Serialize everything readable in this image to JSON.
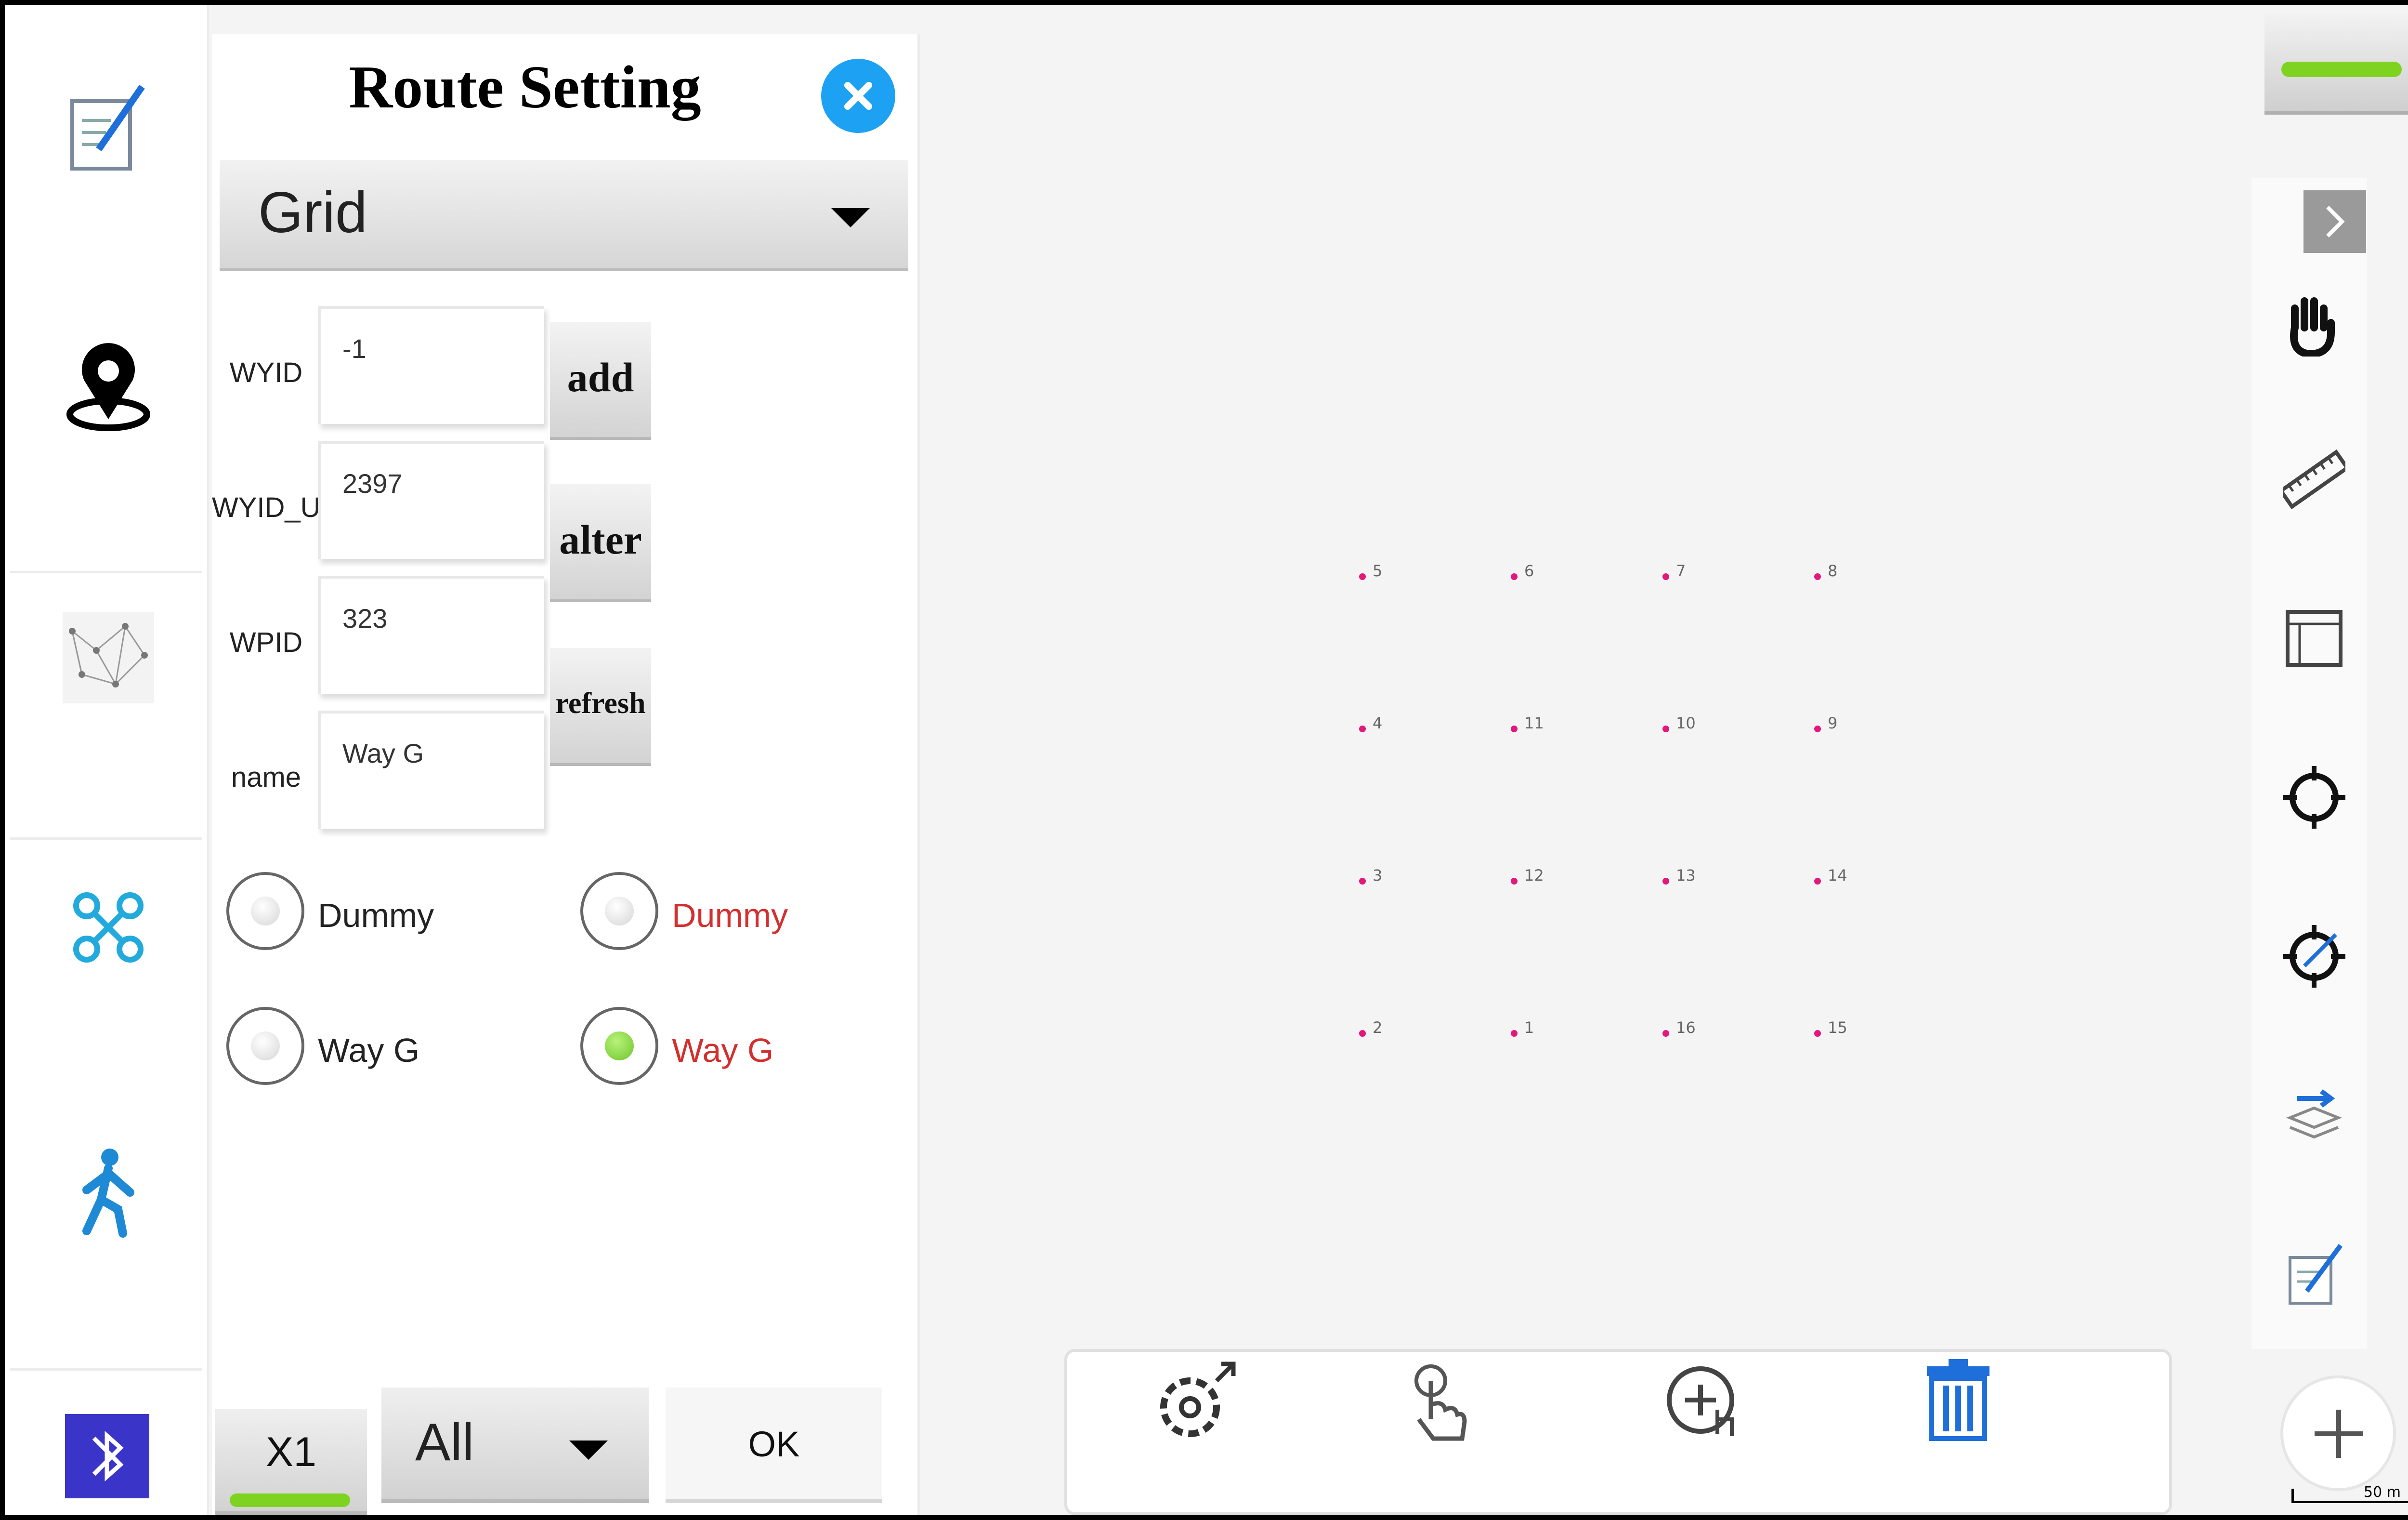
{
  "panel": {
    "title": "Route Setting",
    "route_type": "Grid",
    "fields": [
      {
        "label": "WYID",
        "value": "-1"
      },
      {
        "label": "WYID_U",
        "value": "2397"
      },
      {
        "label": "WPID",
        "value": "323"
      },
      {
        "label": "name",
        "value": "Way G"
      }
    ],
    "buttons": {
      "add": "add",
      "alter": "alter",
      "refresh": "refresh"
    },
    "radios_left": [
      {
        "label": "Dummy",
        "checked": false
      },
      {
        "label": "Way G",
        "checked": false
      }
    ],
    "radios_right": [
      {
        "label": "Dummy",
        "checked": false
      },
      {
        "label": "Way G",
        "checked": true
      }
    ],
    "bottom": {
      "speed": "X1",
      "filter": "All",
      "ok": "OK"
    }
  },
  "left_nav": [
    "edit-note-icon",
    "location-pin-icon",
    "network-map-icon",
    "drone-icon",
    "walking-person-icon",
    "bluetooth-icon"
  ],
  "right_toolbar": [
    "expand-arrow-icon",
    "hand-pan-icon",
    "ruler-icon",
    "frame-icon",
    "crosshair-icon",
    "crosshair-edit-icon",
    "layers-export-icon",
    "edit-note-icon",
    "zoom-in-icon"
  ],
  "map_toolbar": [
    "settings-icon",
    "touch-icon",
    "add-point-icon",
    "delete-icon"
  ],
  "waypoints": [
    {
      "label": "5",
      "col": 0,
      "row": 0
    },
    {
      "label": "6",
      "col": 1,
      "row": 0
    },
    {
      "label": "7",
      "col": 2,
      "row": 0
    },
    {
      "label": "8",
      "col": 3,
      "row": 0
    },
    {
      "label": "4",
      "col": 0,
      "row": 1
    },
    {
      "label": "11",
      "col": 1,
      "row": 1
    },
    {
      "label": "10",
      "col": 2,
      "row": 1
    },
    {
      "label": "9",
      "col": 3,
      "row": 1
    },
    {
      "label": "3",
      "col": 0,
      "row": 2
    },
    {
      "label": "12",
      "col": 1,
      "row": 2
    },
    {
      "label": "13",
      "col": 2,
      "row": 2
    },
    {
      "label": "14",
      "col": 3,
      "row": 2
    },
    {
      "label": "2",
      "col": 0,
      "row": 3
    },
    {
      "label": "1",
      "col": 1,
      "row": 3
    },
    {
      "label": "16",
      "col": 2,
      "row": 3
    },
    {
      "label": "15",
      "col": 3,
      "row": 3
    }
  ],
  "scale": "50 m",
  "colors": {
    "accent_blue": "#1da1f2",
    "waypoint": "#e2187c",
    "selected_text": "#d32f2f",
    "green_indicator": "#7ed321"
  }
}
